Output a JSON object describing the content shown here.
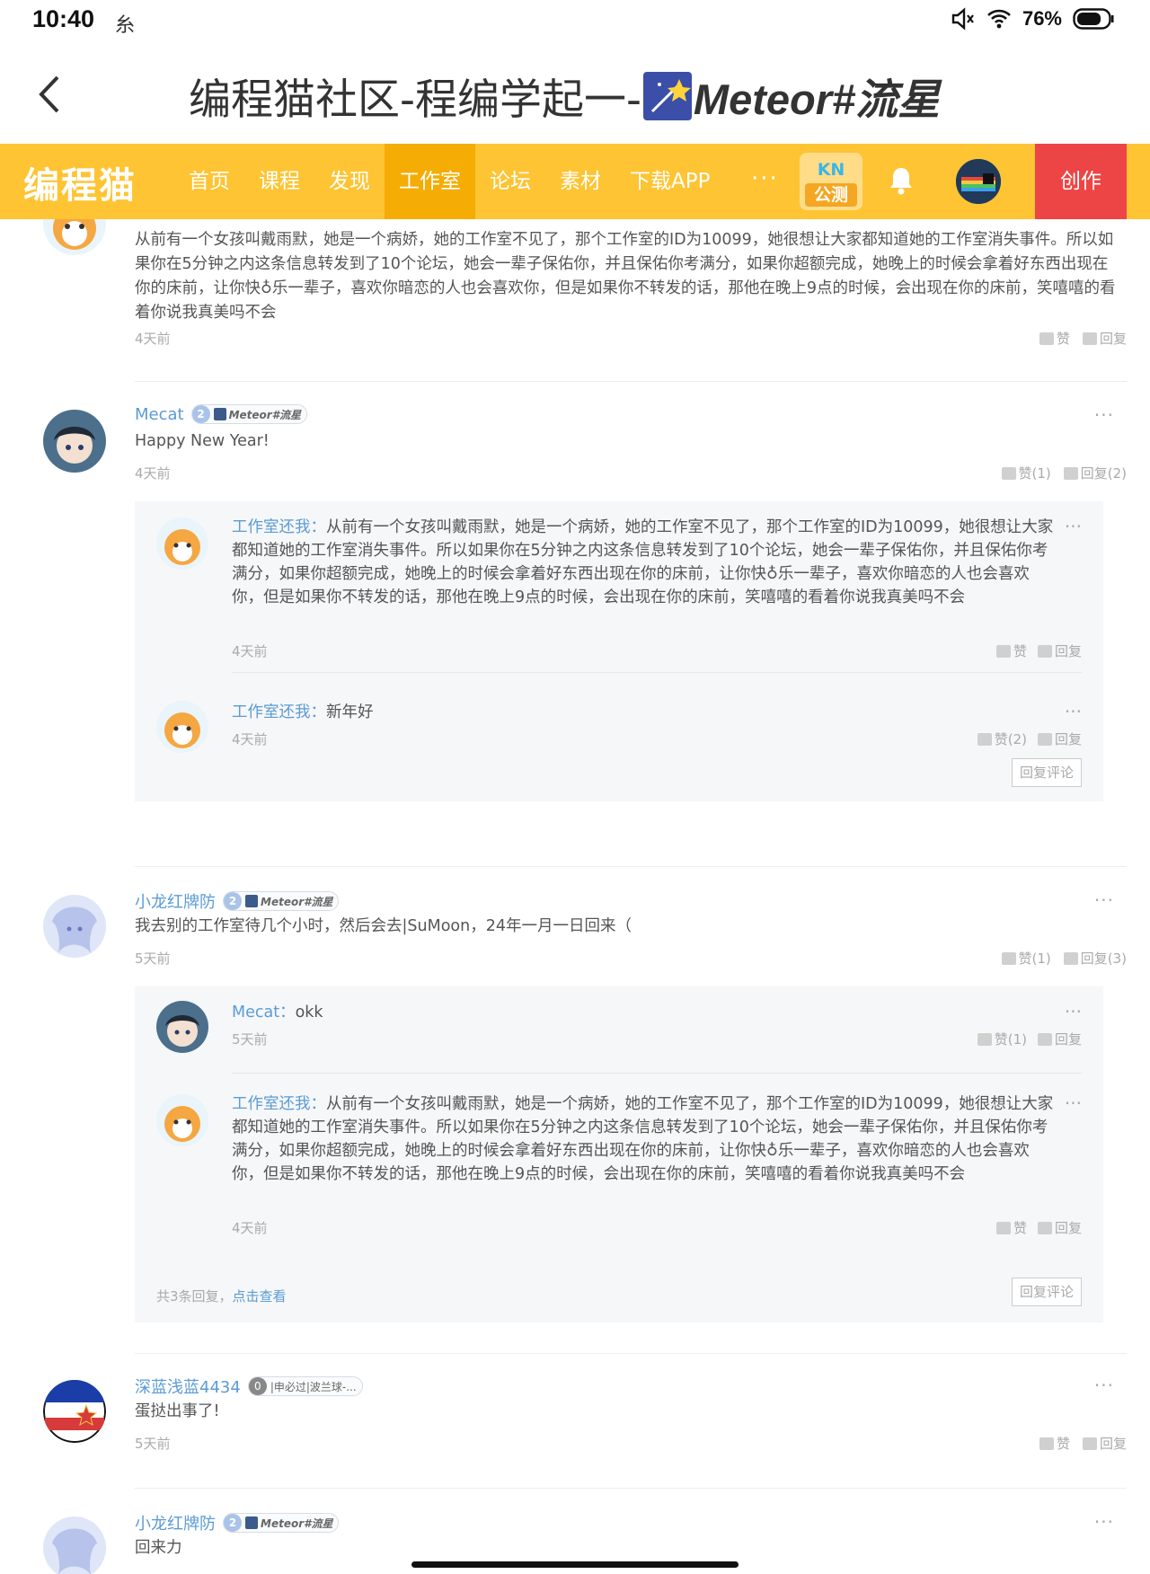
{
  "status": {
    "time": "10:40",
    "battery": "76%",
    "app_icon": "notification-glyph"
  },
  "titlebar": {
    "title_prefix": "编程猫社区-程编学起一-",
    "title_name": "Meteor#流星"
  },
  "nav": {
    "logo": "编程猫",
    "items": [
      "首页",
      "课程",
      "发现",
      "工作室",
      "论坛",
      "素材",
      "下载APP"
    ],
    "active_index": 3,
    "more": "···",
    "kn_top": "KN",
    "kn_bottom": "公测",
    "create": "创作"
  },
  "comments": [
    {
      "text": "从前有一个女孩叫戴雨默，她是一个病娇，她的工作室不见了，那个工作室的ID为10099，她很想让大家都知道她的工作室消失事件。所以如果你在5分钟之内这条信息转发到了10个论坛，她会一辈子保佑你，并且保佑你考满分，如果你超额完成，她晚上的时候会拿着好东西出现在你的床前，让你快♁乐一辈子，喜欢你暗恋的人也会喜欢你，但是如果你不转发的话，那他在晚上9点的时候，会出现在你的床前，笑嘻嘻的看着你说我真美吗不会",
      "time": "4天前",
      "like": "赞",
      "reply": "回复"
    },
    {
      "user": "Mecat",
      "level": "2",
      "badge": "Meteor#流星",
      "text": "Happy New Year!",
      "time": "4天前",
      "like": "赞(1)",
      "reply": "回复(2)",
      "replies": [
        {
          "who": "工作室还我",
          "sep": "：",
          "text": "从前有一个女孩叫戴雨默，她是一个病娇，她的工作室不见了，那个工作室的ID为10099，她很想让大家都知道她的工作室消失事件。所以如果你在5分钟之内这条信息转发到了10个论坛，她会一辈子保佑你，并且保佑你考满分，如果你超额完成，她晚上的时候会拿着好东西出现在你的床前，让你快♁乐一辈子，喜欢你暗恋的人也会喜欢你，但是如果你不转发的话，那他在晚上9点的时候，会出现在你的床前，笑嘻嘻的看着你说我真美吗不会",
          "time": "4天前",
          "like": "赞",
          "reply": "回复"
        },
        {
          "who": "工作室还我",
          "sep": "：",
          "text": "新年好",
          "time": "4天前",
          "like": "赞(2)",
          "reply": "回复"
        }
      ],
      "reply_button": "回复评论"
    },
    {
      "user": "小龙红牌防",
      "level": "2",
      "badge": "Meteor#流星",
      "text": "我去别的工作室待几个小时，然后会去|SuMoon，24年一月一日回来（",
      "time": "5天前",
      "like": "赞(1)",
      "reply": "回复(3)",
      "replies": [
        {
          "who": "Mecat",
          "sep": "：",
          "text": "okk",
          "time": "5天前",
          "like": "赞(1)",
          "reply": "回复"
        },
        {
          "who": "工作室还我",
          "sep": "：",
          "text": "从前有一个女孩叫戴雨默，她是一个病娇，她的工作室不见了，那个工作室的ID为10099，她很想让大家都知道她的工作室消失事件。所以如果你在5分钟之内这条信息转发到了10个论坛，她会一辈子保佑你，并且保佑你考满分，如果你超额完成，她晚上的时候会拿着好东西出现在你的床前，让你快♁乐一辈子，喜欢你暗恋的人也会喜欢你，但是如果你不转发的话，那他在晚上9点的时候，会出现在你的床前，笑嘻嘻的看着你说我真美吗不会",
          "time": "4天前",
          "like": "赞",
          "reply": "回复"
        }
      ],
      "total_prefix": "共3条回复，",
      "total_link": "点击查看",
      "reply_button": "回复评论"
    },
    {
      "user": "深蓝浅蓝4434",
      "level": "0",
      "badge": "|申必过|波兰球-...",
      "text": "蛋挞出事了!",
      "time": "5天前",
      "like": "赞",
      "reply": "回复"
    },
    {
      "user": "小龙红牌防",
      "level": "2",
      "badge": "Meteor#流星",
      "text": "回来力"
    }
  ],
  "colors": {
    "nav_bg": "#fec433",
    "nav_active": "#f5ac05",
    "create_bg": "#ed4545",
    "link": "#5b9bd5"
  }
}
